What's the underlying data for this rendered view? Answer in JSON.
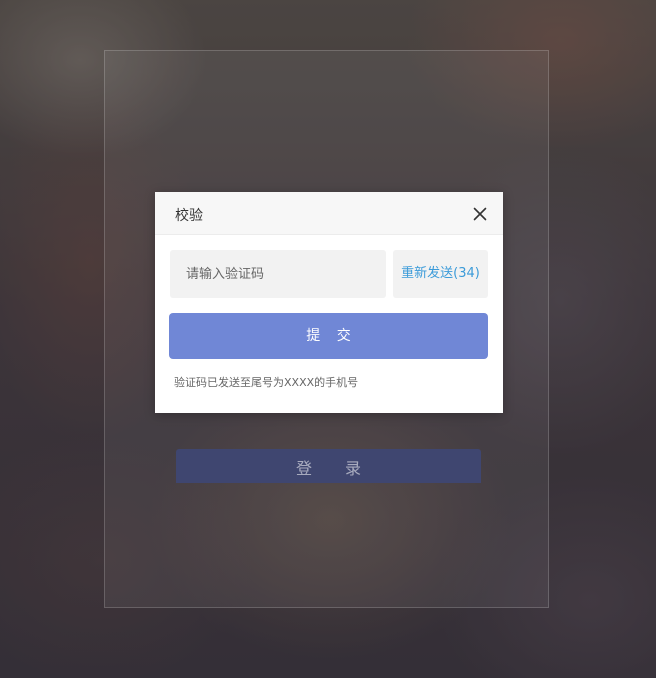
{
  "background": {
    "login_button_label": "登 录"
  },
  "dialog": {
    "title": "校验",
    "code_input": {
      "placeholder": "请输入验证码",
      "value": ""
    },
    "resend_label": "重新发送(34)",
    "submit_label": "提 交",
    "hint": "验证码已发送至尾号为XXXX的手机号"
  },
  "colors": {
    "submit": "#7087d6",
    "resend_text": "#3b9bd9",
    "login_button": "#3f4670"
  },
  "icons": {
    "close": "close-icon"
  }
}
